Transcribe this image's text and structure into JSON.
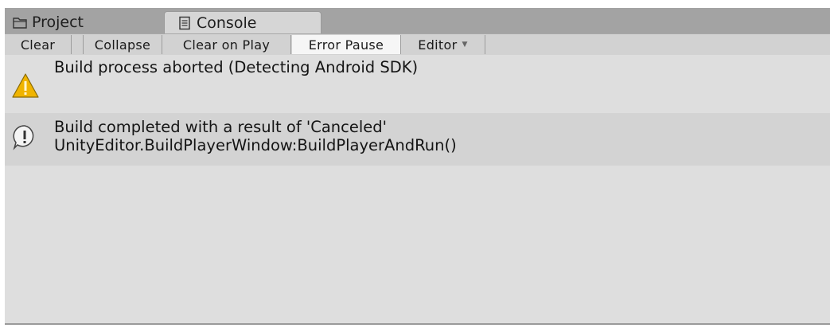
{
  "tabs": [
    {
      "label": "Project",
      "icon": "folder-icon"
    },
    {
      "label": "Console",
      "icon": "console-icon",
      "selected": true
    }
  ],
  "toolbar": {
    "clear_label": "Clear",
    "collapse_label": "Collapse",
    "clear_on_play_label": "Clear on Play",
    "error_pause_label": "Error Pause",
    "error_pause_active": true,
    "editor_label": "Editor"
  },
  "entries": [
    {
      "type": "warning",
      "icon": "warning-icon",
      "line1": "Build process aborted (Detecting Android SDK)",
      "line2": ""
    },
    {
      "type": "info",
      "icon": "info-icon",
      "line1": "Build completed with a result of 'Canceled'",
      "line2": "UnityEditor.BuildPlayerWindow:BuildPlayerAndRun()"
    }
  ],
  "colors": {
    "warning": "#f0b400",
    "tabbar": "#a3a3a3",
    "panel": "#dedede"
  }
}
